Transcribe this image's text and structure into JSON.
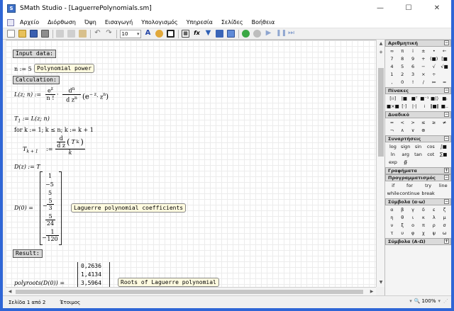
{
  "window": {
    "title": "SMath Studio - [LaguerrePolynomials.sm]",
    "app_icon": "smath-icon"
  },
  "menu": [
    "Αρχείο",
    "Διόρθωση",
    "Όψη",
    "Εισαγωγή",
    "Υπολογισμός",
    "Υπηρεσία",
    "Σελίδες",
    "Βοήθεια"
  ],
  "toolbar": {
    "font_size": "10"
  },
  "doc": {
    "input_label": "Input data:",
    "n_def": "n := 5",
    "n_tip": "Polynomial power",
    "calc_label": "Calculation:",
    "L_left": "L(z; n) :=",
    "e_z": "e",
    "sup_z": "z",
    "n_fact": "n !",
    "d": "d",
    "dz": "d z",
    "sup_n": "n",
    "rhs_inner": "(e",
    "sup_neg_z": "− z",
    "dot_z": "· z",
    "sup_n2": "n",
    "close_paren": ")",
    "T1": "T",
    "T1_sub": "1",
    "T1_rhs": ":= L(z; n)",
    "for_loop": "for  k := 1; k ≤ n; k := k + 1",
    "Tk1": "T",
    "Tk1_sub": "k + 1",
    "Tk1_def": ":=",
    "Tk_num_d": "d",
    "Tk_num_dz": "d z",
    "Tk_T": "T",
    "Tk_sub": "k",
    "Tk_den": "k",
    "D_def": "D(z) := T",
    "D0_left": "D(0) =",
    "coeffs": [
      "1",
      "−5",
      "5",
      "− 5/3",
      "5/24",
      "− 1/120"
    ],
    "coeffs_num": [
      "1",
      "5",
      "5",
      "5",
      "5",
      "1"
    ],
    "coeffs_den": [
      "",
      "",
      "",
      "3",
      "24",
      "120"
    ],
    "coef_tip": "Laguerre polynomial coefficients",
    "result_label": "Result:",
    "roots_left": "polyroots(D(0)) =",
    "roots": [
      "0,2636",
      "1,4134",
      "3,5964"
    ],
    "roots_tip": "Roots of Laguerre polynomial"
  },
  "panels": {
    "arith": {
      "title": "Αριθμητική",
      "rows": [
        [
          "∞",
          "π",
          "i",
          "±",
          "•",
          "←"
        ],
        [
          "7",
          "8",
          "9",
          "+",
          "(■)",
          "[■"
        ],
        [
          "4",
          "5",
          "6",
          "−",
          "√",
          "√■"
        ],
        [
          "1",
          "2",
          "3",
          "×",
          "÷",
          ""
        ],
        [
          ",",
          "0",
          "!",
          "/",
          "≔",
          "="
        ]
      ]
    },
    "matrix": {
      "title": "Πίνακες"
    },
    "bool": {
      "title": "Δυαδικό",
      "rows": [
        [
          "=",
          "<",
          ">",
          "≤",
          "≥",
          "≠"
        ],
        [
          "¬",
          "∧",
          "∨",
          "⊕",
          "",
          ""
        ]
      ]
    },
    "funcs": {
      "title": "Συναρτήσεις",
      "rows": [
        [
          "log",
          "sign",
          "sin",
          "cos",
          "∫■"
        ],
        [
          "ln",
          "arg",
          "tan",
          "cot",
          "∑■"
        ],
        [
          "exp",
          "∯",
          "",
          "",
          ""
        ]
      ]
    },
    "graphs": {
      "title": "Γραφήματα"
    },
    "prog": {
      "title": "Προγραμματισμός",
      "rows": [
        [
          "if",
          "for",
          "try",
          "line"
        ],
        [
          "while",
          "continue",
          "break",
          ""
        ]
      ]
    },
    "greek_lc": {
      "title": "Σύμβολα (α-ω)",
      "rows": [
        [
          "α",
          "β",
          "γ",
          "δ",
          "ε",
          "ζ"
        ],
        [
          "η",
          "θ",
          "ι",
          "κ",
          "λ",
          "μ"
        ],
        [
          "ν",
          "ξ",
          "ο",
          "π",
          "ρ",
          "σ"
        ],
        [
          "τ",
          "υ",
          "φ",
          "χ",
          "ψ",
          "ω"
        ]
      ]
    },
    "greek_uc": {
      "title": "Σύμβολα (Α-Ω)"
    }
  },
  "status": {
    "page": "Σελίδα 1 από 2",
    "state": "Έτοιμος",
    "zoom": "100%"
  }
}
